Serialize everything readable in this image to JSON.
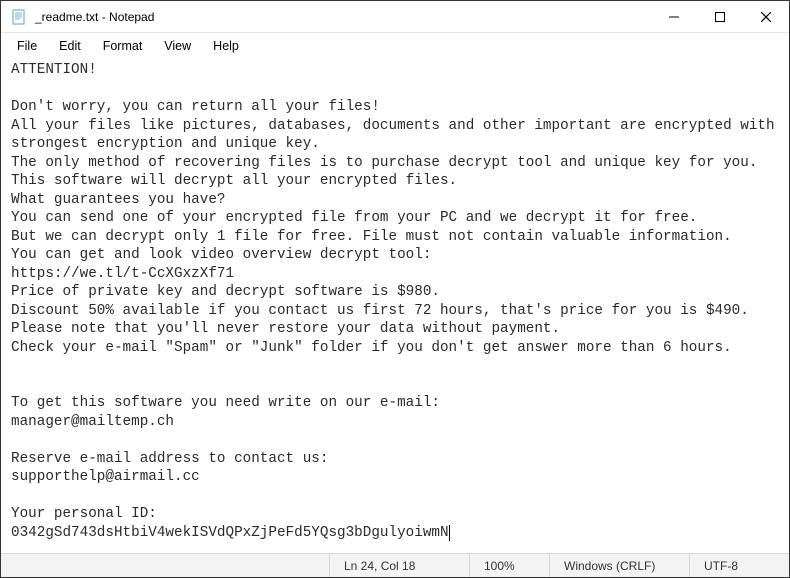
{
  "window": {
    "title": "_readme.txt - Notepad"
  },
  "menu": {
    "file": "File",
    "edit": "Edit",
    "format": "Format",
    "view": "View",
    "help": "Help"
  },
  "document": {
    "text": "ATTENTION!\n\nDon't worry, you can return all your files!\nAll your files like pictures, databases, documents and other important are encrypted with strongest encryption and unique key.\nThe only method of recovering files is to purchase decrypt tool and unique key for you.\nThis software will decrypt all your encrypted files.\nWhat guarantees you have?\nYou can send one of your encrypted file from your PC and we decrypt it for free.\nBut we can decrypt only 1 file for free. File must not contain valuable information.\nYou can get and look video overview decrypt tool:\nhttps://we.tl/t-CcXGxzXf71\nPrice of private key and decrypt software is $980.\nDiscount 50% available if you contact us first 72 hours, that's price for you is $490.\nPlease note that you'll never restore your data without payment.\nCheck your e-mail \"Spam\" or \"Junk\" folder if you don't get answer more than 6 hours.\n\n\nTo get this software you need write on our e-mail:\nmanager@mailtemp.ch\n\nReserve e-mail address to contact us:\nsupporthelp@airmail.cc\n\nYour personal ID:\n0342gSd743dsHtbiV4wekISVdQPxZjPeFd5YQsg3bDgulyoiwmN"
  },
  "status": {
    "position": "Ln 24, Col 18",
    "zoom": "100%",
    "lineending": "Windows (CRLF)",
    "encoding": "UTF-8"
  }
}
